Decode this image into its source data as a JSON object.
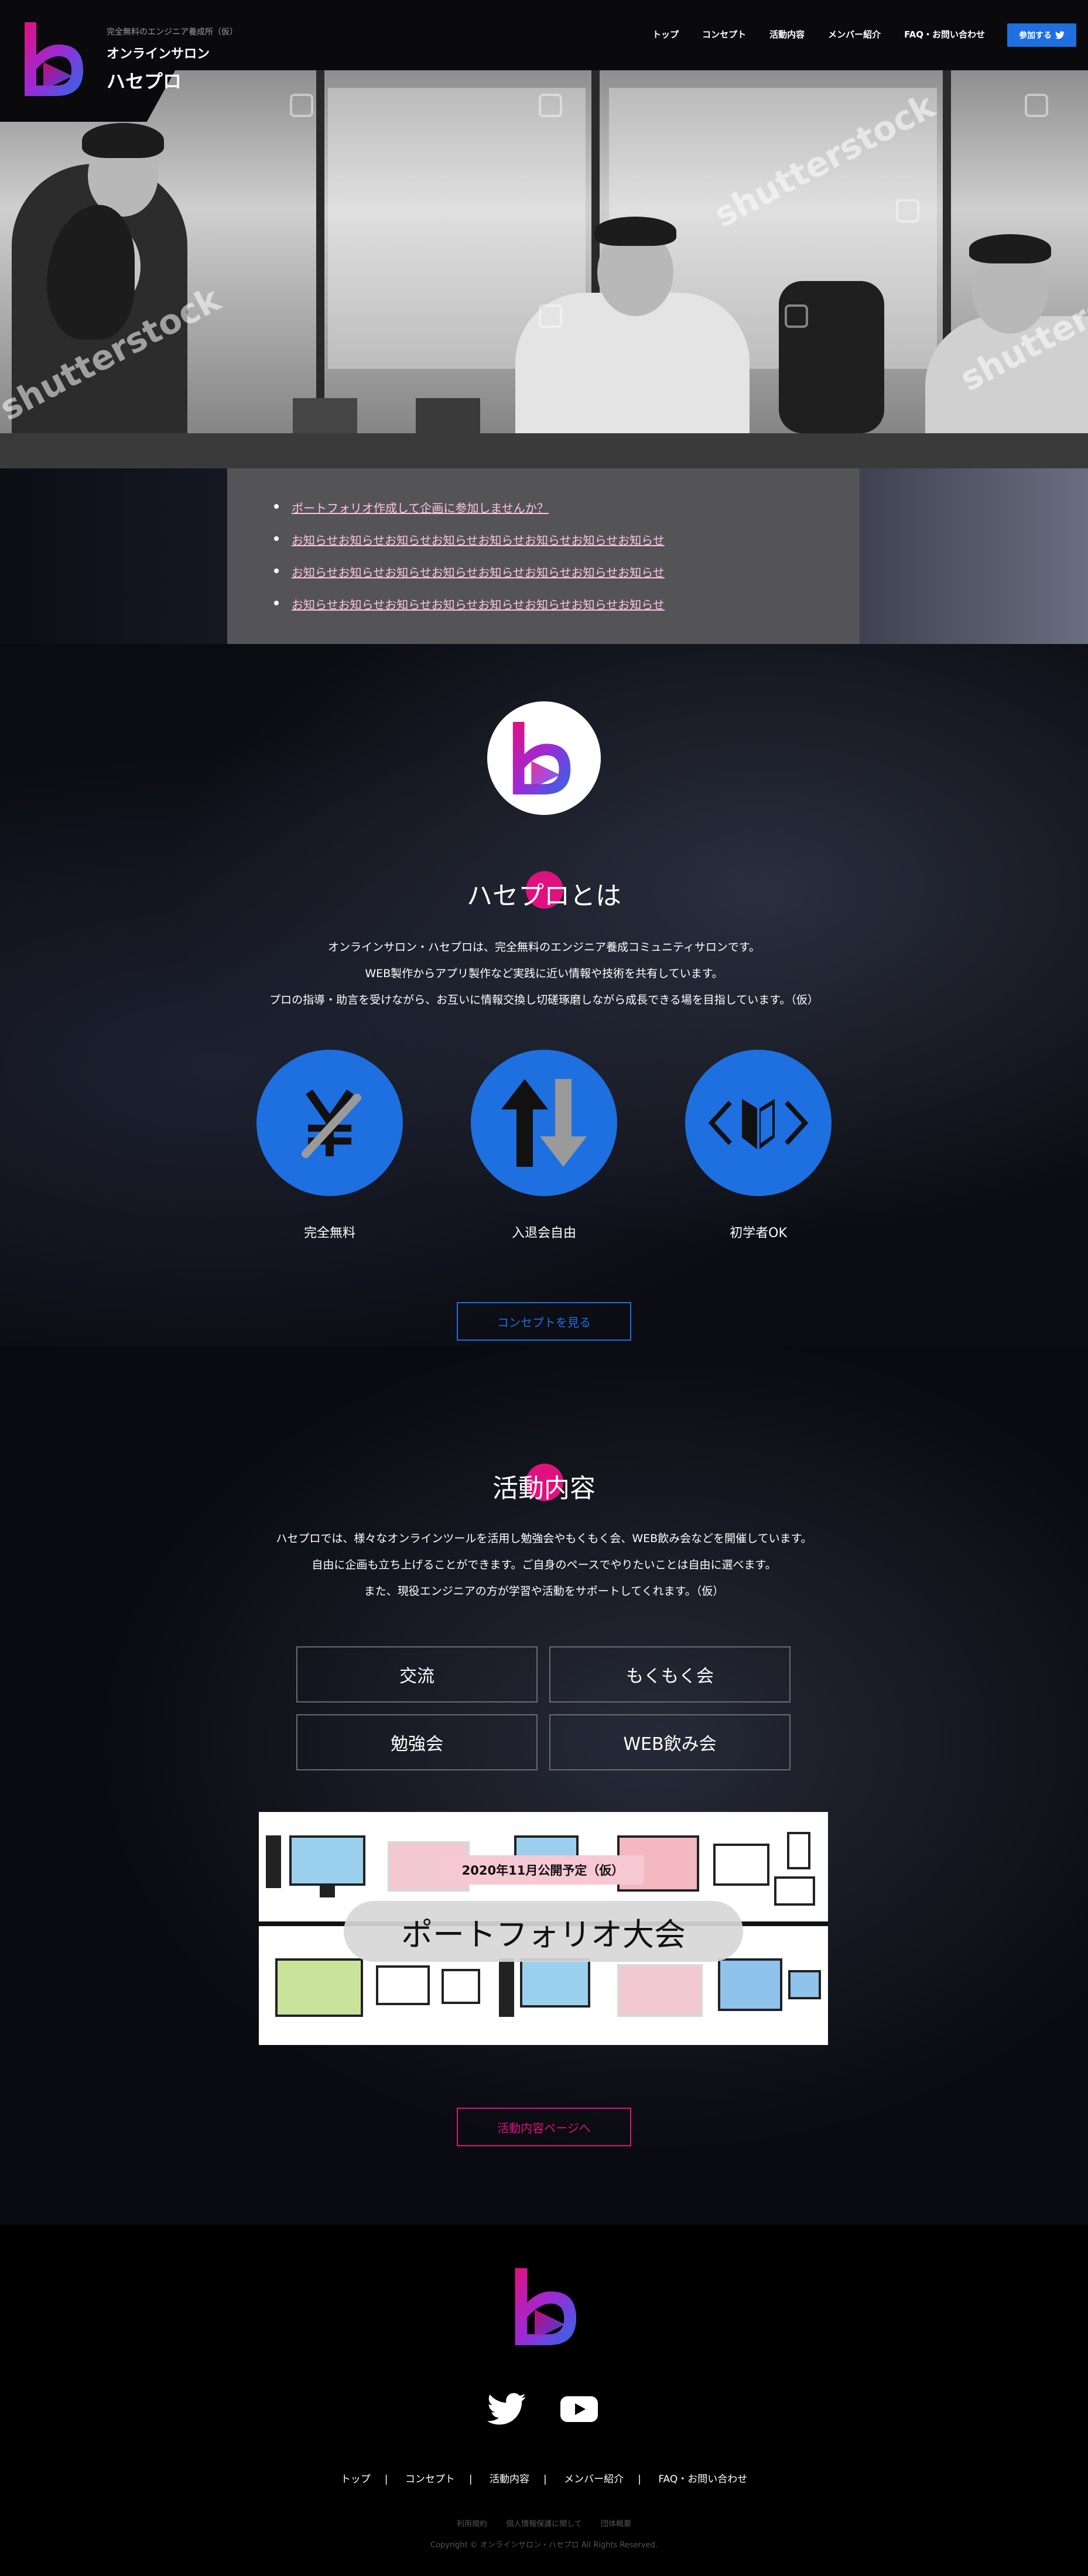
{
  "header": {
    "tagline": "完全無料のエンジニア養成所（仮）",
    "subtitle": "オンラインサロン",
    "brand_name": "ハセプロ",
    "nav": [
      "トップ",
      "コンセプト",
      "活動内容",
      "メンバー紹介",
      "FAQ・お問い合わせ"
    ],
    "join_label": "参加する"
  },
  "hero": {
    "watermarks": [
      "shutterstock",
      "shutterstock",
      "shutterstock"
    ]
  },
  "news": {
    "items": [
      "ポートフォリオ作成して企画に参加しませんか？",
      "お知らせお知らせお知らせお知らせお知らせお知らせお知らせお知らせ",
      "お知らせお知らせお知らせお知らせお知らせお知らせお知らせお知らせ",
      "お知らせお知らせお知らせお知らせお知らせお知らせお知らせお知らせ"
    ]
  },
  "about": {
    "title": "ハセプロとは",
    "lead": [
      "オンラインサロン・ハセプロは、完全無料のエンジニア養成コミュニティサロンです。",
      "WEB製作からアプリ製作など実践に近い情報や技術を共有しています。",
      "プロの指導・助言を受けながら、お互いに情報交換し切磋琢磨しながら成長できる場を目指しています。（仮）"
    ],
    "features": [
      {
        "label": "完全無料",
        "icon": "yen-icon"
      },
      {
        "label": "入退会自由",
        "icon": "up-down-arrows-icon"
      },
      {
        "label": "初学者OK",
        "icon": "beginner-mark-icon"
      }
    ],
    "cta": "コンセプトを見る"
  },
  "activities": {
    "title": "活動内容",
    "lead": [
      "ハセプロでは、様々なオンラインツールを活用し勉強会やもくもく会、WEB飲み会などを開催しています。",
      "自由に企画も立ち上げることができます。ご自身のペースでやりたいことは自由に選べます。",
      "また、現役エンジニアの方が学習や活動をサポートしてくれます。（仮）"
    ],
    "items": [
      "交流",
      "もくもく会",
      "勉強会",
      "WEB飲み会"
    ],
    "banner": {
      "date": "2020年11月公開予定（仮）",
      "title": "ポートフォリオ大会"
    },
    "cta": "活動内容ページへ"
  },
  "footer": {
    "nav": [
      "トップ",
      "コンセプト",
      "活動内容",
      "メンバー紹介",
      "FAQ・お問い合わせ"
    ],
    "legal": [
      "利用規約",
      "個人情報保護に関して",
      "団体概要"
    ],
    "copyright": "Copyright © オンラインサロン・ハセプロ All Rights Reserved."
  },
  "colors": {
    "accent_blue": "#1e6fe0",
    "accent_pink": "#e0117f",
    "background": "#0a0b10"
  }
}
